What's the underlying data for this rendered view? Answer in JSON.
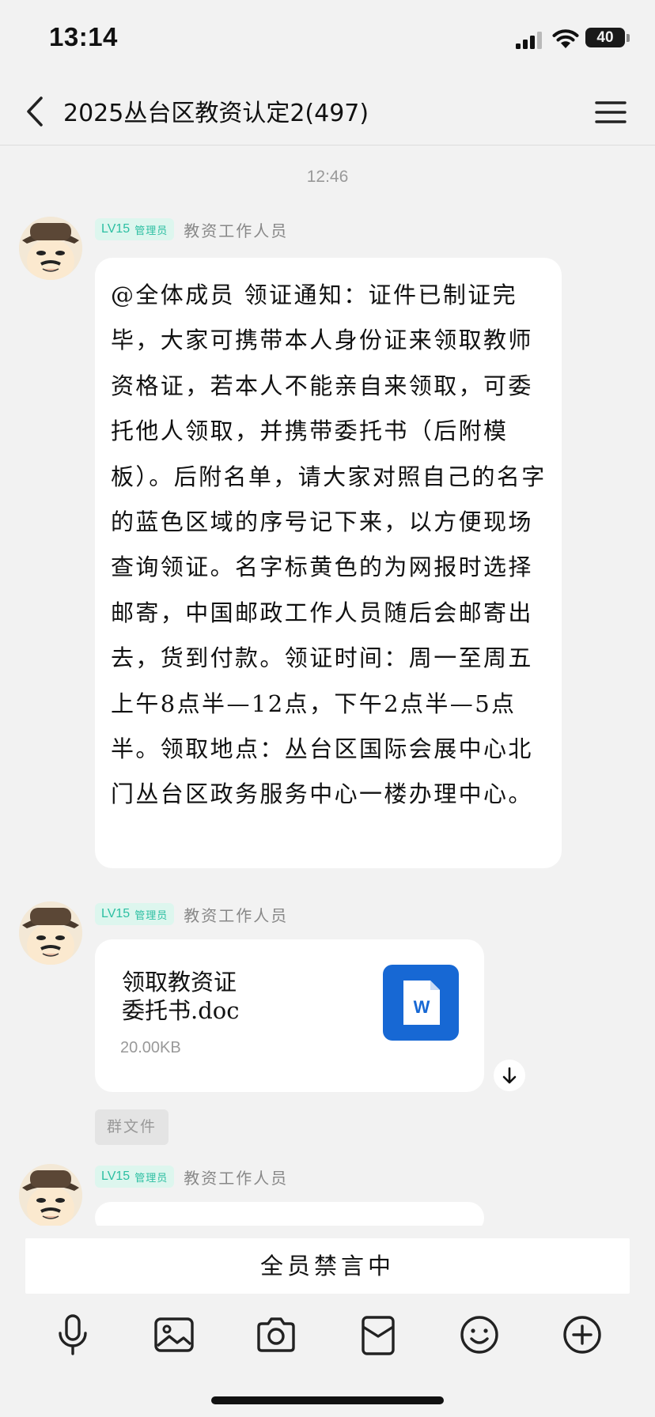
{
  "status_bar": {
    "time": "13:14",
    "battery": "40"
  },
  "nav": {
    "title": "2025丛台区教资认定2(497)"
  },
  "chat": {
    "timestamp": "12:46",
    "messages": [
      {
        "level": "LV15",
        "role": "管理员",
        "sender": "教资工作人员",
        "text": "@全体成员 领证通知：证件已制证完毕，大家可携带本人身份证来领取教师资格证，若本人不能亲自来领取，可委托他人领取，并携带委托书（后附模板）。后附名单，请大家对照自己的名字的蓝色区域的序号记下来，以方便现场查询领证。名字标黄色的为网报时选择邮寄，中国邮政工作人员随后会邮寄出去，货到付款。领证时间：周一至周五上午8点半—12点，下午2点半—5点半。领取地点：丛台区国际会展中心北门丛台区政务服务中心一楼办理中心。"
      },
      {
        "level": "LV15",
        "role": "管理员",
        "sender": "教资工作人员",
        "file_name_line1": "领取教资证",
        "file_name_line2": "委托书.doc",
        "file_size": "20.00KB",
        "file_icon": "word-doc-icon",
        "file_icon_letter": "W",
        "tag": "群文件"
      },
      {
        "level": "LV15",
        "role": "管理员",
        "sender": "教资工作人员"
      }
    ]
  },
  "input": {
    "muted_text": "全员禁言中",
    "tools": [
      "microphone-icon",
      "image-icon",
      "camera-icon",
      "red-packet-icon",
      "emoji-icon",
      "plus-icon"
    ]
  }
}
